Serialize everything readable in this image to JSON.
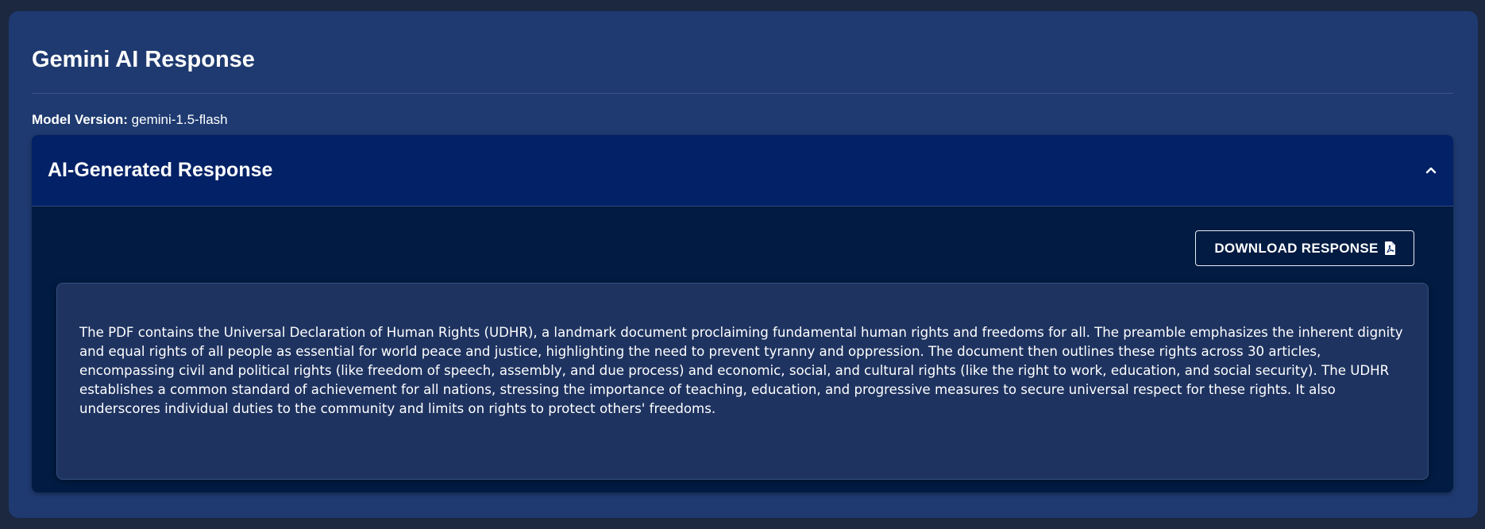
{
  "card": {
    "title": "Gemini AI Response",
    "model_label": "Model Version:",
    "model_value": "gemini-1.5-flash"
  },
  "accordion": {
    "title": "AI-Generated Response",
    "toggle_icon": "chevron-up-icon",
    "expanded": true
  },
  "download": {
    "label": "DOWNLOAD RESPONSE",
    "icon": "file-pdf-icon"
  },
  "response": {
    "text": "The PDF contains the Universal Declaration of Human Rights (UDHR), a landmark document proclaiming fundamental human rights and freedoms for all. The preamble emphasizes the inherent dignity and equal rights of all people as essential for world peace and justice, highlighting the need to prevent tyranny and oppression. The document then outlines these rights across 30 articles, encompassing civil and political rights (like freedom of speech, assembly, and due process) and economic, social, and cultural rights (like the right to work, education, and social security). The UDHR establishes a common standard of achievement for all nations, stressing the importance of teaching, education, and progressive measures to secure universal respect for these rights. It also underscores individual duties to the community and limits on rights to protect others' freedoms."
  },
  "colors": {
    "page_background": "#1c2740",
    "card_background": "#1e3a70",
    "accordion_header": "#022166",
    "accordion_body": "#011b42",
    "response_box": "#1e3360",
    "text": "#ffffff"
  }
}
